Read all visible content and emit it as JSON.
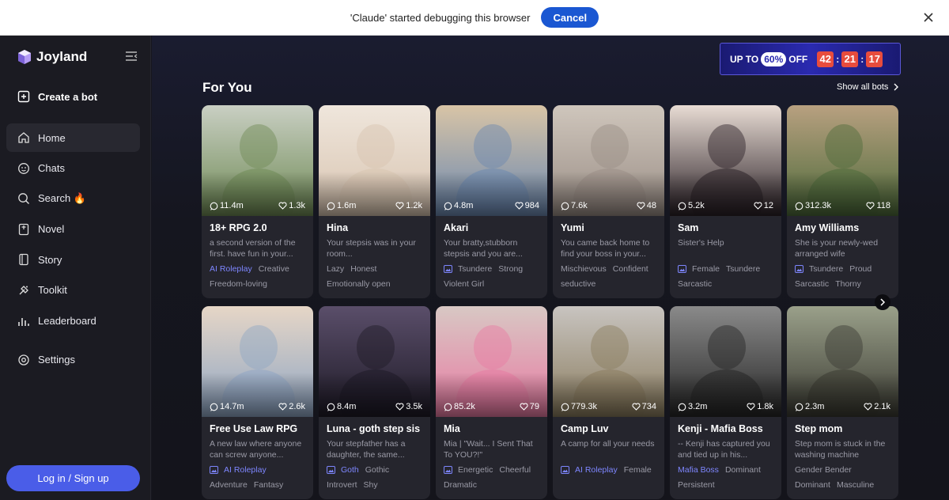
{
  "debugbar": {
    "message": "'Claude' started debugging this browser",
    "cancel_label": "Cancel"
  },
  "sidebar": {
    "logo": "Joyland",
    "create_label": "Create a bot",
    "items": [
      {
        "label": "Home",
        "icon": "home-icon"
      },
      {
        "label": "Chats",
        "icon": "chat-icon"
      },
      {
        "label": "Search 🔥",
        "icon": "search-icon"
      },
      {
        "label": "Novel",
        "icon": "novel-icon"
      },
      {
        "label": "Story",
        "icon": "story-icon"
      },
      {
        "label": "Toolkit",
        "icon": "toolkit-icon"
      },
      {
        "label": "Leaderboard",
        "icon": "leaderboard-icon"
      }
    ],
    "settings_label": "Settings",
    "login_label": "Log in / Sign up"
  },
  "promo": {
    "up_to": "UP TO",
    "percent": "60%",
    "off": "OFF",
    "hours": "42",
    "minutes": "21",
    "seconds": "17"
  },
  "section": {
    "title": "For You",
    "show_all": "Show all bots"
  },
  "cards": [
    {
      "chats": "11.4m",
      "likes": "1.3k",
      "name": "18+ RPG 2.0",
      "desc": "a second version of the first. have fun in your...",
      "tags": [
        "AI Roleplay",
        "Creative",
        "Freedom-loving"
      ],
      "color1": "#c9cfc3",
      "color2": "#6f8a55"
    },
    {
      "chats": "1.6m",
      "likes": "1.2k",
      "name": "Hina",
      "desc": "Your stepsis was in your room...",
      "tags": [
        "Lazy",
        "Honest",
        "Emotionally open"
      ],
      "color1": "#efe6dc",
      "color2": "#d8c4b0"
    },
    {
      "chats": "4.8m",
      "likes": "984",
      "name": "Akari",
      "desc": "Your bratty,stubborn stepsis and you are...",
      "tags": [
        "Tsundere",
        "Strong",
        "Violent Girl"
      ],
      "color1": "#d8c4a6",
      "color2": "#6b88b0"
    },
    {
      "chats": "7.6k",
      "likes": "48",
      "name": "Yumi",
      "desc": "You came back home to find your boss in your...",
      "tags": [
        "Mischievous",
        "Confident",
        "seductive"
      ],
      "color1": "#cfc6bc",
      "color2": "#9a8e86"
    },
    {
      "chats": "5.2k",
      "likes": "12",
      "name": "Sam",
      "desc": "Sister's Help",
      "tags": [
        "Female",
        "Tsundere",
        "Sarcastic"
      ],
      "color1": "#e8dcd4",
      "color2": "#2a2026"
    },
    {
      "chats": "312.3k",
      "likes": "118",
      "name": "Amy Williams",
      "desc": "She is your newly-wed arranged wife",
      "tags": [
        "Tsundere",
        "Proud",
        "Sarcastic",
        "Thorny"
      ],
      "color1": "#b8a080",
      "color2": "#4d6a3a"
    },
    {
      "chats": "14.7m",
      "likes": "2.6k",
      "name": "Free Use Law RPG",
      "desc": "A new law where anyone can screw anyone...",
      "tags": [
        "AI Roleplay",
        "Adventure",
        "Fantasy"
      ],
      "color1": "#e6d6c6",
      "color2": "#8fa6c4"
    },
    {
      "chats": "8.4m",
      "likes": "3.5k",
      "name": "Luna - goth step sis",
      "desc": "Your stepfather has a daughter, the same...",
      "tags": [
        "Goth",
        "Gothic",
        "Introvert",
        "Shy"
      ],
      "color1": "#5a4e6a",
      "color2": "#1e1a26"
    },
    {
      "chats": "85.2k",
      "likes": "79",
      "name": "Mia",
      "desc": "Mia | \"Wait... I Sent That To YOU?!\"",
      "tags": [
        "Energetic",
        "Cheerful",
        "Dramatic"
      ],
      "color1": "#d8c8c4",
      "color2": "#e87aa2"
    },
    {
      "chats": "779.3k",
      "likes": "734",
      "name": "Camp Luv",
      "desc": "A camp for all your needs",
      "tags": [
        "AI Roleplay",
        "Female"
      ],
      "color1": "#c8c4c0",
      "color2": "#8a7c5e"
    },
    {
      "chats": "3.2m",
      "likes": "1.8k",
      "name": "Kenji - Mafia Boss",
      "desc": "-- Kenji has captured you and tied up in his...",
      "tags": [
        "Mafia Boss",
        "Dominant",
        "Persistent"
      ],
      "color1": "#8a8a8a",
      "color2": "#262626"
    },
    {
      "chats": "2.3m",
      "likes": "2.1k",
      "name": "Step mom",
      "desc": "Step mom is stuck in the washing machine",
      "tags": [
        "Gender Bender",
        "Dominant",
        "Masculine"
      ],
      "color1": "#9aa08a",
      "color2": "#3a3a32"
    }
  ]
}
